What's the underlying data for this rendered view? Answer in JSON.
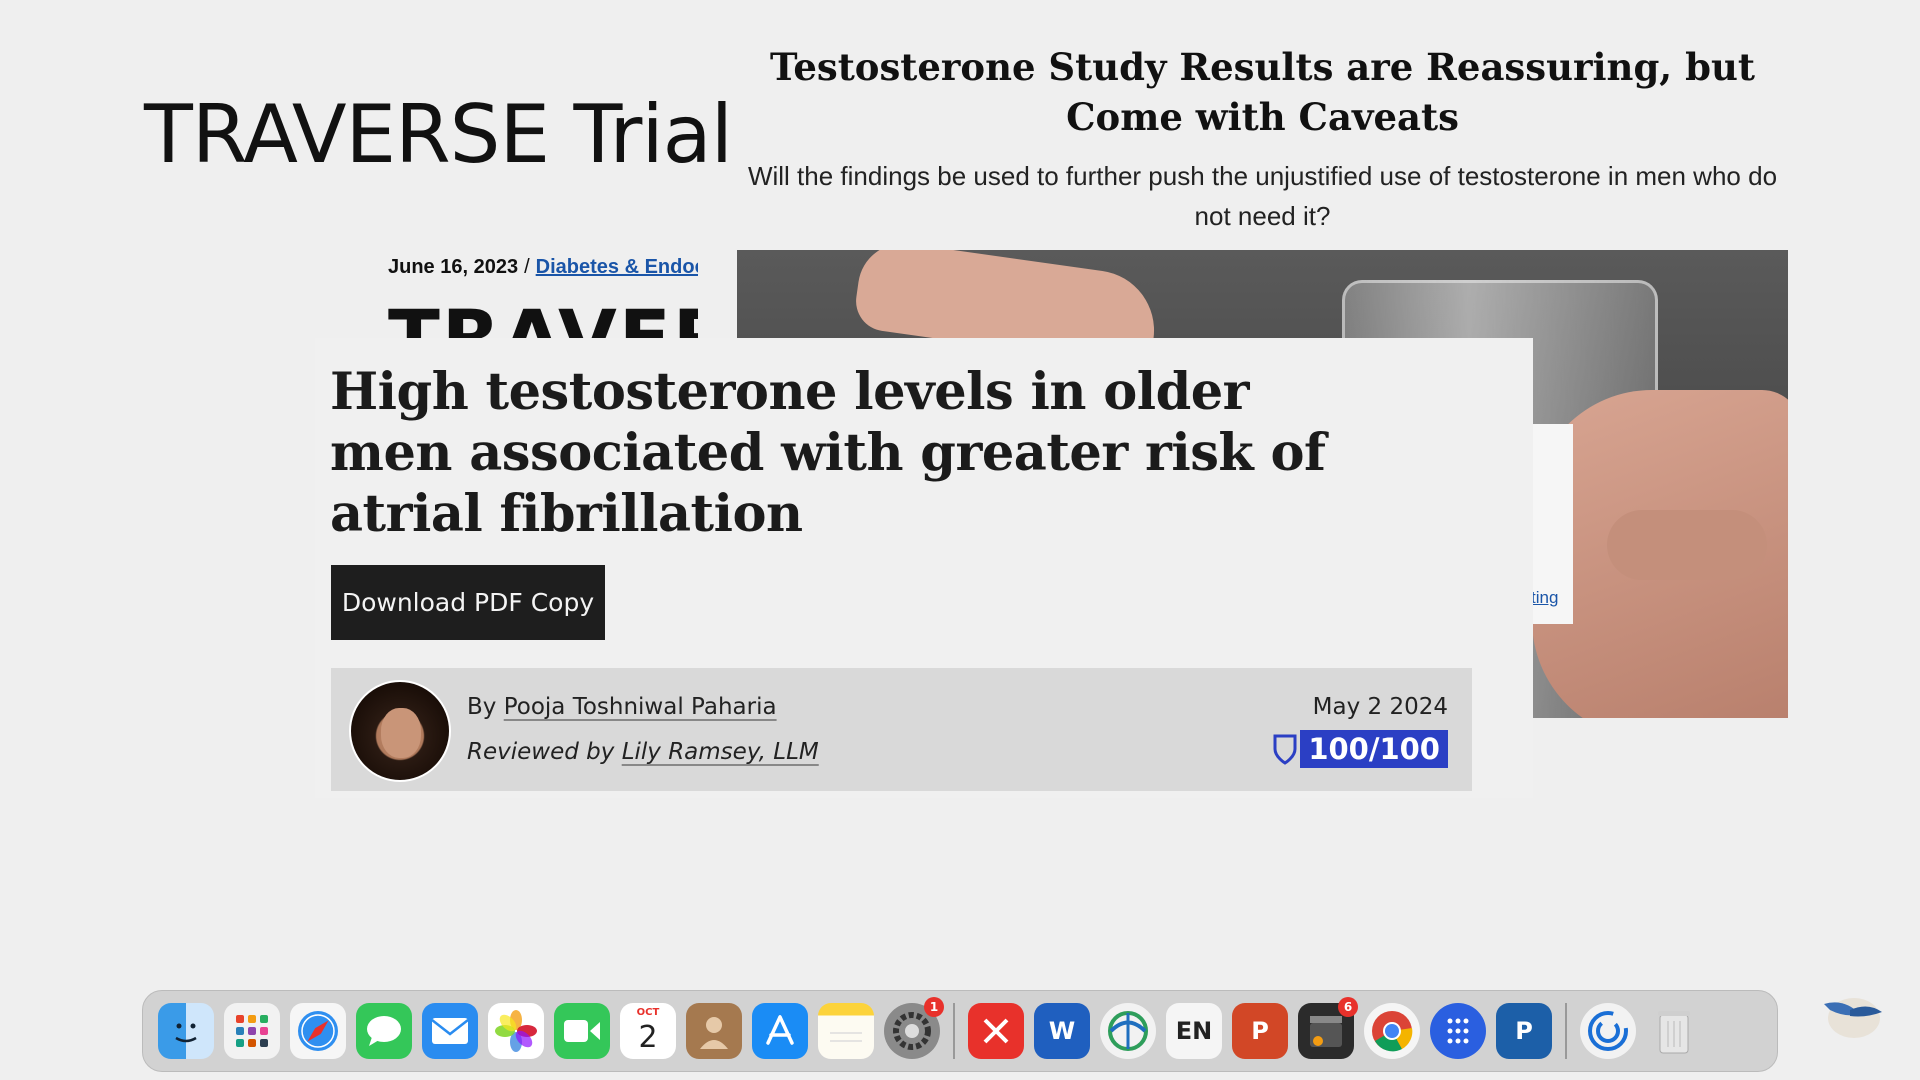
{
  "slide": {
    "title": "TRAVERSE Trial"
  },
  "right_article": {
    "headline": "Testosterone Study Results are Reassuring, but Come with Caveats",
    "subheadline": "Will the findings be used to further push the unjustified use of testosterone in men who do not need it?"
  },
  "snippet": {
    "date": "June 16, 2023",
    "separator": "/",
    "category": "Diabetes & Endoc",
    "brand": "TRAVERSE",
    "side_link": "ting"
  },
  "article": {
    "headline": "High testosterone levels in older men associated with greater risk of atrial fibrillation",
    "download_label": "Download PDF Copy",
    "byline": {
      "by_prefix": "By",
      "author": "Pooja Toshniwal Paharia",
      "reviewed_prefix": "Reviewed by",
      "reviewer": "Lily Ramsey, LLM",
      "date": "May 2 2024",
      "score": "100/100"
    }
  },
  "dock": {
    "calendar_month": "OCT",
    "calendar_day": "2",
    "settings_badge": "1",
    "app_badge": "6",
    "en_label": "EN",
    "word_label": "W",
    "ppt_label": "P",
    "pulse_label": "P"
  },
  "colors": {
    "link": "#1a55a8",
    "score_badge": "#2b3fc4",
    "button": "#1e1e1e"
  }
}
